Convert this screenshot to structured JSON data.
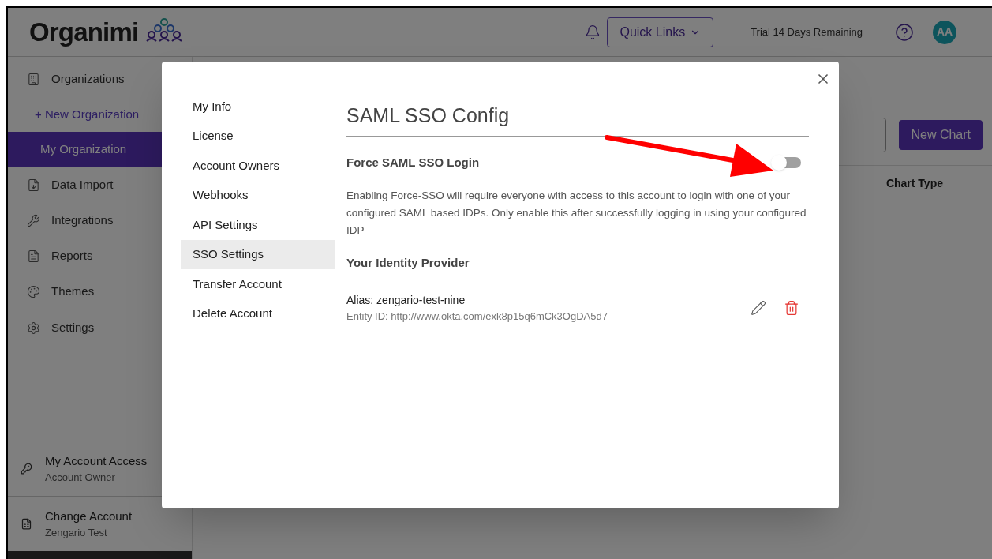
{
  "header": {
    "logo": "Organimi",
    "quick_links": "Quick Links",
    "trial": "Trial 14 Days Remaining",
    "avatar": "AA"
  },
  "sidebar": {
    "items": [
      {
        "kind": "nav",
        "label": "Organizations"
      },
      {
        "kind": "action",
        "label": "+ New Organization"
      },
      {
        "kind": "current",
        "label": "My Organization"
      },
      {
        "kind": "nav",
        "label": "Data Import"
      },
      {
        "kind": "nav",
        "label": "Integrations"
      },
      {
        "kind": "nav",
        "label": "Reports"
      },
      {
        "kind": "nav",
        "label": "Themes"
      },
      {
        "kind": "nav",
        "label": "Settings"
      }
    ],
    "footer": [
      {
        "title": "My Account Access",
        "subtitle": "Account Owner"
      },
      {
        "title": "Change Account",
        "subtitle": "Zengario Test"
      }
    ]
  },
  "main": {
    "new_chart": "New Chart",
    "column": "Chart Type"
  },
  "modal": {
    "menu": [
      {
        "label": "My Info",
        "selected": false
      },
      {
        "label": "License",
        "selected": false
      },
      {
        "label": "Account Owners",
        "selected": false
      },
      {
        "label": "Webhooks",
        "selected": false
      },
      {
        "label": "API Settings",
        "selected": false
      },
      {
        "label": "SSO Settings",
        "selected": true
      },
      {
        "label": "Transfer Account",
        "selected": false
      },
      {
        "label": "Delete Account",
        "selected": false
      }
    ],
    "title": "SAML SSO Config",
    "force_label": "Force SAML SSO Login",
    "force_on": false,
    "description": "Enabling Force-SSO will require everyone with access to this account to login with one of your configured SAML based IDPs. Only enable this after successfully logging in using your configured IDP",
    "provider_heading": "Your Identity Provider",
    "provider": {
      "alias": "Alias: zengario-test-nine",
      "entity_id": "Entity ID: http://www.okta.com/exk8p15q6mCk3OgDA5d7"
    }
  }
}
